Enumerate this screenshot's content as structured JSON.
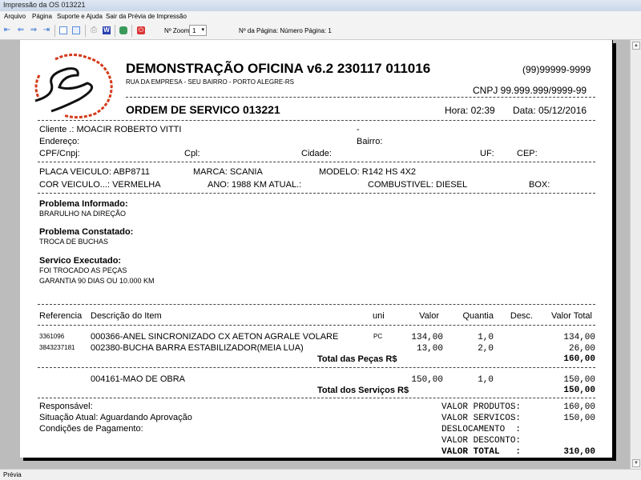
{
  "window": {
    "title": "Impressão da OS 013221"
  },
  "menu": [
    "Arquivo",
    "Página",
    "Suporte e Ajuda",
    "Sair da Prévia de Impressão"
  ],
  "toolbar": {
    "zoom_label": "Nº Zoom",
    "zoom_value": "1",
    "page_info": "Nº da Página: Número Página: 1"
  },
  "status": "Prévia",
  "doc": {
    "company": "DEMONSTRAÇÃO OFICINA v6.2 230117 011016",
    "address": "RUA DA EMPRESA - SEU BAIRRO - PORTO ALEGRE-RS",
    "phone": "(99)99999-9999",
    "cnpj": "CNPJ 99.999.999/9999-99",
    "os_title": "ORDEM DE SERVICO 013221",
    "hora": "Hora: 02:39",
    "data": "Data: 05/12/2016",
    "cliente": "Cliente   .: MOACIR ROBERTO VITTI",
    "dash": "-",
    "endereco": "Endereço:",
    "bairro": "Bairro:",
    "cpf": "CPF/Cnpj:",
    "cpl": "Cpl:",
    "cidade": "Cidade:",
    "uf": "UF:",
    "cep": "CEP:",
    "placa": "PLACA VEICULO: ABP8711",
    "marca": "MARCA: SCANIA",
    "modelo": "MODELO: R142 HS 4X2",
    "cor": "COR VEICULO...: VERMELHA",
    "ano": "ANO: 1988 KM ATUAL.:",
    "combustivel": "COMBUSTIVEL: DIESEL",
    "box": "BOX:",
    "problema_informado_label": "Problema Informado:",
    "problema_informado": "BRARULHO NA DIREÇÃO",
    "problema_constatado_label": "Problema Constatado:",
    "problema_constatado": "TROCA DE BUCHAS",
    "servico_label": "Servico Executado:",
    "servico_1": "FOI TROCADO AS PEÇAS",
    "servico_2": "GARANTIA 90 DIAS OU 10.000 KM",
    "columns": [
      "Referencia",
      "Descrição do Item",
      "uni",
      "Valor",
      "Quantia",
      "Desc.",
      "Valor Total"
    ],
    "items": [
      {
        "ref": "3361096",
        "desc": "000366-ANEL SINCRONIZADO CX AETON AGRALE VOLARE",
        "uni": "PC",
        "valor": "134,00",
        "qtd": "1,0",
        "total": "134,00"
      },
      {
        "ref": "3843237181",
        "desc": "002380-BUCHA BARRA ESTABILIZADOR(MEIA LUA)",
        "uni": "",
        "valor": "13,00",
        "qtd": "2,0",
        "total": "26,00"
      }
    ],
    "total_pecas_label": "Total das Peças R$",
    "total_pecas": "160,00",
    "services": [
      {
        "desc": "004161-MAO DE OBRA",
        "valor": "150,00",
        "qtd": "1,0",
        "total": "150,00"
      }
    ],
    "total_servicos_label": "Total dos Serviços R$",
    "total_servicos": "150,00",
    "responsavel": "Responsável:",
    "situacao": "Situação Atual: Aguardando Aprovação",
    "condicoes": "Condições de Pagamento:",
    "summary": [
      {
        "label": "VALOR PRODUTOS:",
        "value": "160,00"
      },
      {
        "label": "VALOR SERVICOS:",
        "value": "150,00"
      },
      {
        "label": "DESLOCAMENTO  :",
        "value": ""
      },
      {
        "label": "VALOR DESCONTO:",
        "value": ""
      },
      {
        "label": "VALOR TOTAL   :",
        "value": "310,00"
      }
    ]
  }
}
